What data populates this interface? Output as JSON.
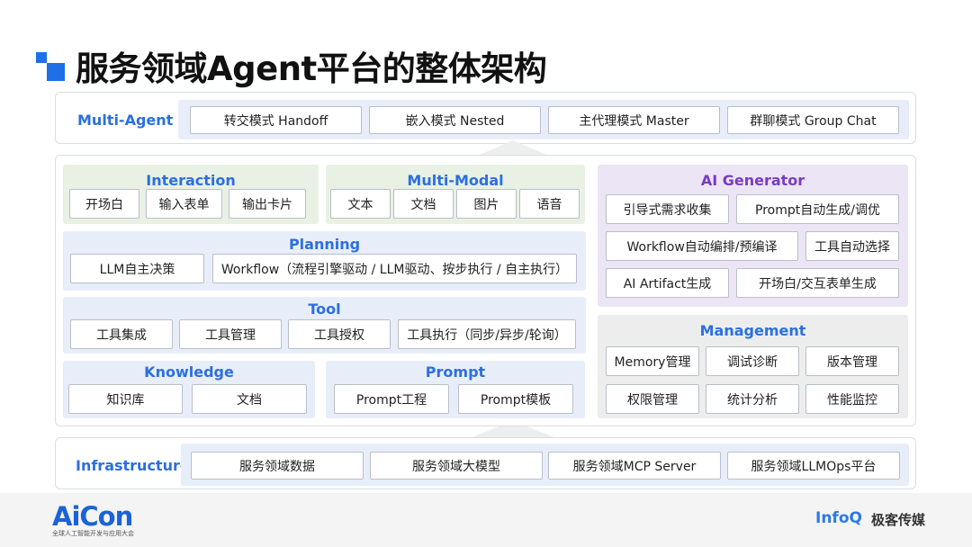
{
  "title": "服务领域Agent平台的整体架构",
  "multi_agent": {
    "label": "Multi-Agent",
    "items": [
      "转交模式 Handoff",
      "嵌入模式 Nested",
      "主代理模式 Master",
      "群聊模式 Group Chat"
    ]
  },
  "interaction": {
    "title": "Interaction",
    "items": [
      "开场白",
      "输入表单",
      "输出卡片"
    ]
  },
  "multi_modal": {
    "title": "Multi-Modal",
    "items": [
      "文本",
      "文档",
      "图片",
      "语音"
    ]
  },
  "planning": {
    "title": "Planning",
    "items": [
      "LLM自主决策",
      "Workflow（流程引擎驱动 / LLM驱动、按步执行 / 自主执行）"
    ]
  },
  "tool": {
    "title": "Tool",
    "items": [
      "工具集成",
      "工具管理",
      "工具授权",
      "工具执行（同步/异步/轮询）"
    ]
  },
  "knowledge": {
    "title": "Knowledge",
    "items": [
      "知识库",
      "文档"
    ]
  },
  "prompt": {
    "title": "Prompt",
    "items": [
      "Prompt工程",
      "Prompt模板"
    ]
  },
  "ai_generator": {
    "title": "AI Generator",
    "items": [
      "引导式需求收集",
      "Prompt自动生成/调优",
      "Workflow自动编排/预编译",
      "工具自动选择",
      "AI Artifact生成",
      "开场白/交互表单生成"
    ]
  },
  "management": {
    "title": "Management",
    "items": [
      "Memory管理",
      "调试诊断",
      "版本管理",
      "权限管理",
      "统计分析",
      "性能监控"
    ]
  },
  "infrastructure": {
    "label": "Infrastructure",
    "items": [
      "服务领域数据",
      "服务领域大模型",
      "服务领域MCP Server",
      "服务领域LLMOps平台"
    ]
  },
  "footer": {
    "aicon": "AiCon",
    "aicon_sub": "全球人工智能开发与应用大会",
    "infoq": "InfoQ",
    "jike": "极客传媒"
  },
  "colors": {
    "accent_blue": "#2b6fe0",
    "ai_generator_purple": "#7a3bc4"
  }
}
